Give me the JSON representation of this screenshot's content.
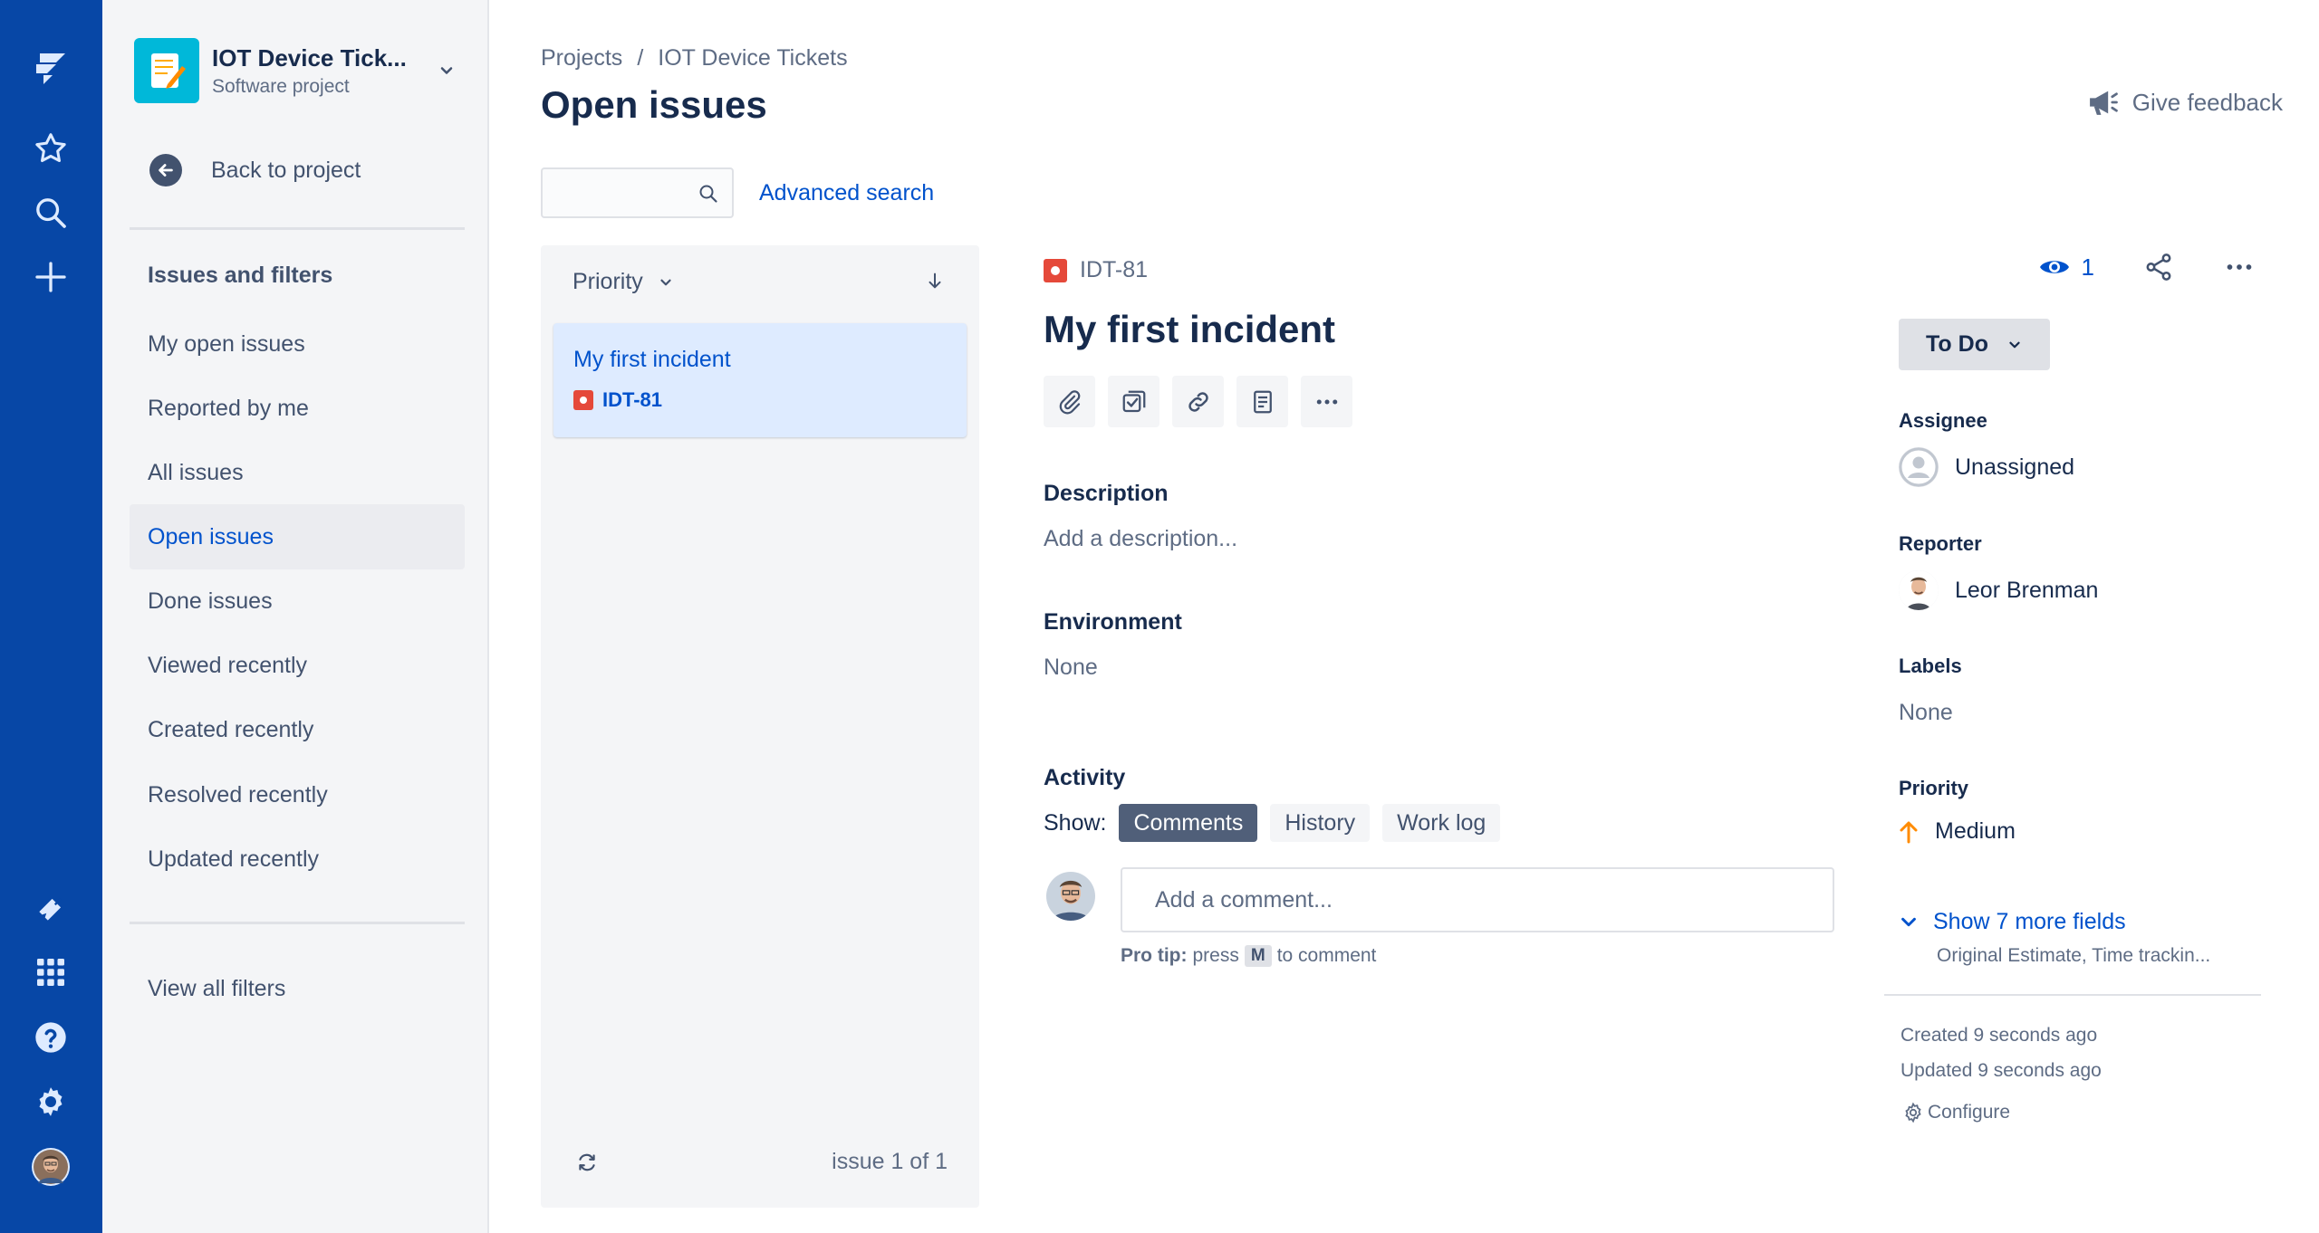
{
  "project": {
    "name": "IOT Device Tick...",
    "type": "Software project"
  },
  "sidebar": {
    "back_label": "Back to project",
    "section_title": "Issues and filters",
    "items": [
      {
        "label": "My open issues"
      },
      {
        "label": "Reported by me"
      },
      {
        "label": "All issues"
      },
      {
        "label": "Open issues"
      },
      {
        "label": "Done issues"
      },
      {
        "label": "Viewed recently"
      },
      {
        "label": "Created recently"
      },
      {
        "label": "Resolved recently"
      },
      {
        "label": "Updated recently"
      }
    ],
    "view_all_filters": "View all filters"
  },
  "header": {
    "breadcrumbs": [
      "Projects",
      "/",
      "IOT Device Tickets"
    ],
    "title": "Open issues",
    "feedback_label": "Give feedback"
  },
  "search": {
    "value": "",
    "advanced_label": "Advanced search"
  },
  "list": {
    "sort_label": "Priority",
    "items": [
      {
        "title": "My first incident",
        "key": "IDT-81"
      }
    ],
    "count_label": "issue 1 of 1"
  },
  "issue": {
    "key": "IDT-81",
    "title": "My first incident",
    "description_label": "Description",
    "description_placeholder": "Add a description...",
    "environment_label": "Environment",
    "environment_value": "None",
    "activity_label": "Activity",
    "show_label": "Show:",
    "activity_tabs": [
      "Comments",
      "History",
      "Work log"
    ],
    "comment_placeholder": "Add a comment...",
    "protip": {
      "prefix": "Pro tip:",
      "press": "press",
      "key": "M",
      "suffix": "to comment"
    },
    "watchers": "1",
    "status": "To Do",
    "assignee_label": "Assignee",
    "assignee": "Unassigned",
    "reporter_label": "Reporter",
    "reporter": "Leor Brenman",
    "labels_label": "Labels",
    "labels_value": "None",
    "priority_label": "Priority",
    "priority": "Medium",
    "more_fields": "Show 7 more fields",
    "more_fields_sub": "Original Estimate, Time trackin...",
    "created": "Created 9 seconds ago",
    "updated": "Updated 9 seconds ago",
    "configure": "Configure"
  },
  "colors": {
    "nav": "#0747a6",
    "link": "#0052cc",
    "bug": "#e5493a",
    "priority_medium": "#ff8b00"
  }
}
